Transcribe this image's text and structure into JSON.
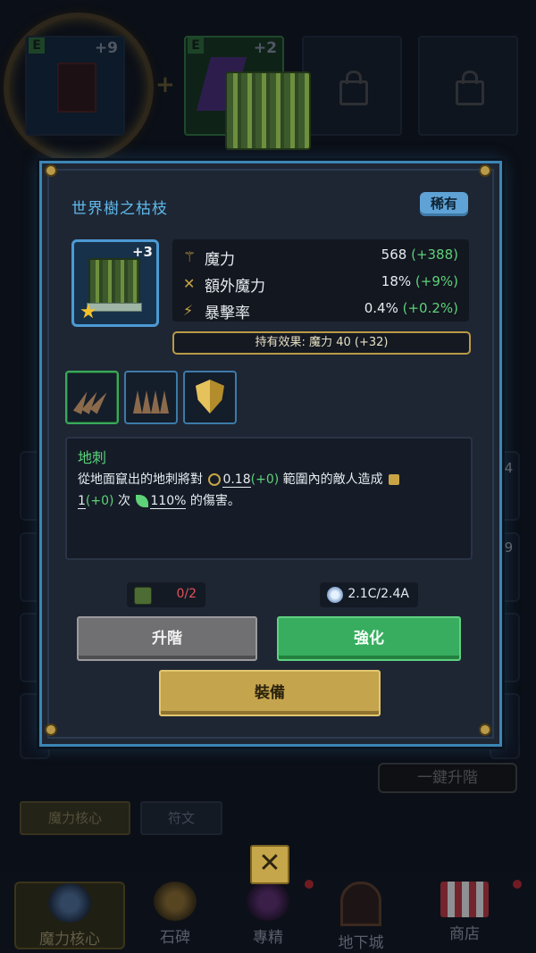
{
  "background": {
    "slots": [
      {
        "tier": "E",
        "plus": "+9"
      },
      {
        "tier": "E",
        "plus": "+2"
      }
    ],
    "side_badges": [
      "+4",
      "+9"
    ],
    "upgrade_all_label": "一鍵升階",
    "tabs": [
      "魔力核心",
      "符文"
    ],
    "nav": [
      {
        "label": "魔力核心",
        "icon": "mana-core-icon"
      },
      {
        "label": "石碑",
        "icon": "stele-icon"
      },
      {
        "label": "專精",
        "icon": "mastery-icon"
      },
      {
        "label": "地下城",
        "icon": "dungeon-icon"
      },
      {
        "label": "商店",
        "icon": "shop-icon"
      }
    ]
  },
  "modal": {
    "item_name": "世界樹之枯枝",
    "rarity": "稀有",
    "item_level": "+3",
    "stats": [
      {
        "label": "魔力",
        "value": "568",
        "bonus": "(+388)",
        "icon": "magic-wand-icon"
      },
      {
        "label": "額外魔力",
        "value": "18%",
        "bonus": "(+9%)",
        "icon": "crossed-wands-icon"
      },
      {
        "label": "暴擊率",
        "value": "0.4%",
        "bonus": "(+0.2%)",
        "icon": "crit-wand-icon"
      }
    ],
    "passive_effect": "持有效果: 魔力 40 (+32)",
    "skills": [
      {
        "name": "earth-spike-skill",
        "selected": true
      },
      {
        "name": "spike-field-skill",
        "selected": false
      },
      {
        "name": "golden-shield-skill",
        "selected": false
      }
    ],
    "skill_description": {
      "title": "地刺",
      "part1": "從地面竄出的地刺將對",
      "radius": "0.18",
      "radius_bonus": "(+0)",
      "part2": "範圍內的敵人造成",
      "hits": "1",
      "hits_bonus": "(+0)",
      "part3": "次",
      "damage": "110%",
      "part4": "的傷害。"
    },
    "costs": {
      "material": "0/2",
      "crystal": "2.1C/2.4A"
    },
    "buttons": {
      "ascend": "升階",
      "enhance": "強化",
      "equip": "裝備"
    },
    "colors": {
      "accent_blue": "#5fb9ea",
      "bonus_green": "#5fd178",
      "gold": "#c5a44e",
      "cost_red": "#e0525a"
    }
  }
}
